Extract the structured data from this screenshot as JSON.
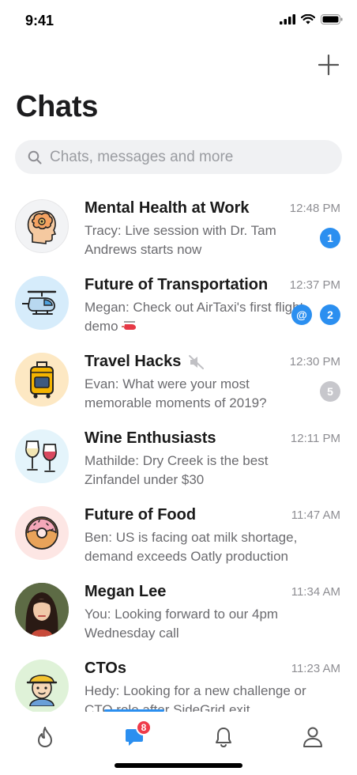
{
  "status_bar": {
    "time": "9:41"
  },
  "header": {
    "title": "Chats"
  },
  "search": {
    "placeholder": "Chats, messages and more"
  },
  "chats": [
    {
      "name": "Mental Health at Work",
      "time": "12:48 PM",
      "preview": "Tracy: Live session with Dr. Tam Andrews starts now",
      "badges": [
        "1"
      ],
      "muted": false
    },
    {
      "name": "Future of Transportation",
      "time": "12:37 PM",
      "preview": "Megan: Check out AirTaxi's first flight demo",
      "badges": [
        "@",
        "2"
      ],
      "muted": false
    },
    {
      "name": "Travel Hacks",
      "time": "12:30 PM",
      "preview": "Evan: What were your most memorable moments of 2019?",
      "badges": [
        "5"
      ],
      "muted": true
    },
    {
      "name": "Wine Enthusiasts",
      "time": "12:11 PM",
      "preview": "Mathilde: Dry Creek is the best Zinfandel under $30",
      "badges": [],
      "muted": false
    },
    {
      "name": "Future of Food",
      "time": "11:47 AM",
      "preview": "Ben: US is facing oat milk shortage, demand exceeds Oatly production",
      "badges": [],
      "muted": false
    },
    {
      "name": "Megan Lee",
      "time": "11:34 AM",
      "preview": "You: Looking forward to our 4pm Wednesday call",
      "badges": [],
      "muted": false
    },
    {
      "name": "CTOs",
      "time": "11:23 AM",
      "preview": "Hedy: Looking for a new challenge or CTO role after SideGrid exit",
      "badges": [],
      "muted": false
    }
  ],
  "tab_bar": {
    "tabs": [
      {
        "icon": "flame-icon",
        "active": false
      },
      {
        "icon": "chat-bubble-icon",
        "active": true,
        "badge": "8"
      },
      {
        "icon": "bell-icon",
        "active": false
      },
      {
        "icon": "profile-icon",
        "active": false
      }
    ]
  },
  "colors": {
    "accent": "#2b8ff0",
    "badge_red": "#ef3b4a",
    "muted_badge": "#c7c7cc"
  }
}
